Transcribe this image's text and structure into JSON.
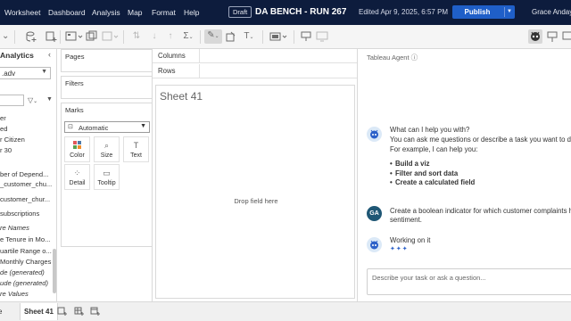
{
  "menu": {
    "items": [
      "Worksheet",
      "Dashboard",
      "Analysis",
      "Map",
      "Format",
      "Help"
    ]
  },
  "workbook": {
    "status_badge": "Draft",
    "title": "DA BENCH - RUN 267",
    "edited": "Edited Apr 9, 2025, 6:57 PM",
    "publish_label": "Publish",
    "user_name": "Grace Anday"
  },
  "data_pane": {
    "title": "Analytics",
    "datasource": ".adv",
    "fields": [
      {
        "label": "er",
        "italic": false
      },
      {
        "label": "ed",
        "italic": false
      },
      {
        "label": "r Citizen",
        "italic": false
      },
      {
        "label": "r 30",
        "italic": false
      },
      {
        "label": "ber of Depend...",
        "italic": false
      },
      {
        "label": "_customer_chu...",
        "italic": false
      },
      {
        "label": "customer_chur...",
        "italic": false
      },
      {
        "label": "subscriptions",
        "italic": false
      },
      {
        "label": "re Names",
        "italic": true
      },
      {
        "label": "e Tenure in Mo...",
        "italic": false
      },
      {
        "label": "uartile Range o...",
        "italic": false
      },
      {
        "label": "Monthly Charges",
        "italic": false
      },
      {
        "label": "de (generated)",
        "italic": true
      },
      {
        "label": "ude (generated)",
        "italic": true
      },
      {
        "label": "re Values",
        "italic": true
      }
    ]
  },
  "shelves": {
    "pages": "Pages",
    "filters": "Filters",
    "marks": "Marks",
    "mark_type": "Automatic",
    "mark_buttons": [
      {
        "label": "Color",
        "icon": "color-icon"
      },
      {
        "label": "Size",
        "icon": "size-icon"
      },
      {
        "label": "Text",
        "icon": "text-icon"
      },
      {
        "label": "Detail",
        "icon": "detail-icon"
      },
      {
        "label": "Tooltip",
        "icon": "tooltip-icon"
      }
    ]
  },
  "canvas": {
    "columns_label": "Columns",
    "rows_label": "Rows",
    "sheet_title": "Sheet 41",
    "drop_hint": "Drop field here"
  },
  "agent": {
    "title": "Tableau Agent",
    "greeting": "What can I help you with?",
    "intro_line1": "You can ask me questions or describe a task you want to do i",
    "intro_line2": "For example, I can help you:",
    "suggestions": [
      "Build a viz",
      "Filter and sort data",
      "Create a calculated field"
    ],
    "user_initials": "GA",
    "user_msg_line1": "Create a boolean indicator for which customer complaints ha",
    "user_msg_line2": "sentiment.",
    "status": "Working on it",
    "sparkles": "✦✦✦",
    "input_placeholder": "Describe your task or ask a question..."
  },
  "bottom_tabs": {
    "partial_tab": "e",
    "active_tab": "Sheet 41"
  },
  "colors": {
    "topbar_bg": "#0d1c3d",
    "publish_bg": "#1f5fc8",
    "user_avatar_bg": "#1f5775",
    "sparkle": "#2c61c9"
  }
}
